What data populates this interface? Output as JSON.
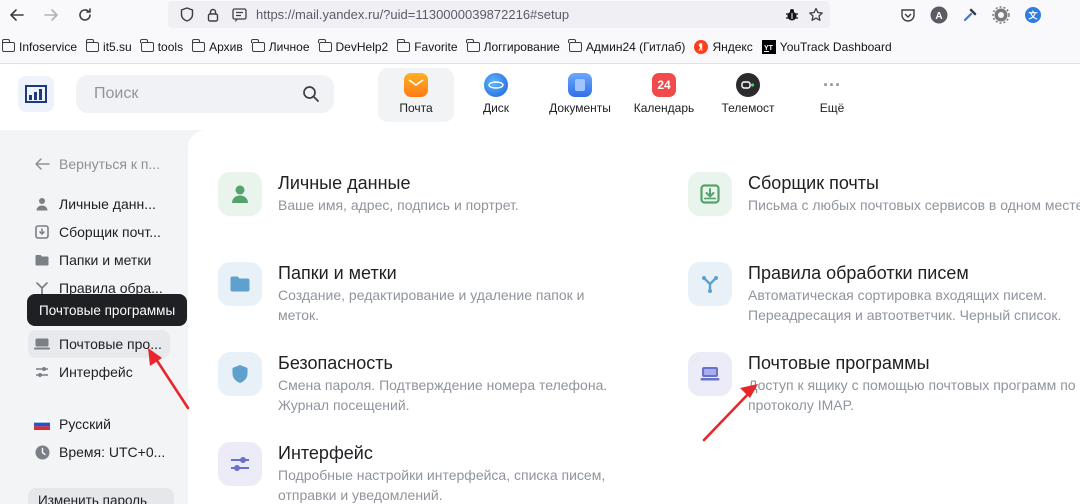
{
  "browser": {
    "url_host": "https://mail.yandex.ru",
    "url_path": "/?uid=1130000039872216#setup"
  },
  "bookmarks": [
    {
      "label": "Infoservice"
    },
    {
      "label": "it5.su"
    },
    {
      "label": "tools"
    },
    {
      "label": "Архив"
    },
    {
      "label": "Личное"
    },
    {
      "label": "DevHelp2"
    },
    {
      "label": "Favorite"
    },
    {
      "label": "Логгирование"
    },
    {
      "label": "Админ24 (Гитлаб)"
    },
    {
      "label": "Яндекс"
    },
    {
      "label": "YouTrack Dashboard"
    }
  ],
  "header": {
    "search_placeholder": "Поиск",
    "services": [
      {
        "label": "Почта",
        "color": "#ff9d1f"
      },
      {
        "label": "Диск",
        "color": "#2a7af0"
      },
      {
        "label": "Документы",
        "color": "#4b8ef5"
      },
      {
        "label": "Календарь",
        "color": "#f24a4a",
        "badge": "24"
      },
      {
        "label": "Телемост",
        "color": "#2b2b2e"
      },
      {
        "label": "Ещё",
        "color": "#8f959c"
      }
    ]
  },
  "sidebar": {
    "back": "Вернуться к п...",
    "items": [
      {
        "label": "Личные данн..."
      },
      {
        "label": "Сборщик почт..."
      },
      {
        "label": "Папки и метки"
      },
      {
        "label": "Правила обра..."
      },
      {
        "label": "Почтовые про..."
      },
      {
        "label": "Интерфейс"
      }
    ],
    "language": "Русский",
    "time": "Время: UTC+0...",
    "tooltip": "Почтовые программы",
    "change_password": "Изменить пароль"
  },
  "cards": [
    {
      "title": "Личные данные",
      "desc": "Ваше имя, адрес, подпись и портрет."
    },
    {
      "title": "Сборщик почты",
      "desc": "Письма с любых почтовых сервисов в одном месте."
    },
    {
      "title": "Папки и метки",
      "desc": "Создание, редактирование и удаление папок и меток."
    },
    {
      "title": "Правила обработки писем",
      "desc": "Автоматическая сортировка входящих писем. Переадресация и автоответчик. Черный список."
    },
    {
      "title": "Безопасность",
      "desc": "Смена пароля. Подтверждение номера телефона. Журнал посещений."
    },
    {
      "title": "Почтовые программы",
      "desc": "Доступ к ящику с помощью почтовых программ по протоколу IMAP."
    },
    {
      "title": "Интерфейс",
      "desc": "Подробные настройки интерфейса, списка писем, отправки и уведомлений."
    }
  ],
  "colors": {
    "green_card": "#e9f4ec",
    "blue_card": "#e8f1f8",
    "lilac_card": "#ecebf8",
    "annotation_arrow": "#e8262b"
  }
}
